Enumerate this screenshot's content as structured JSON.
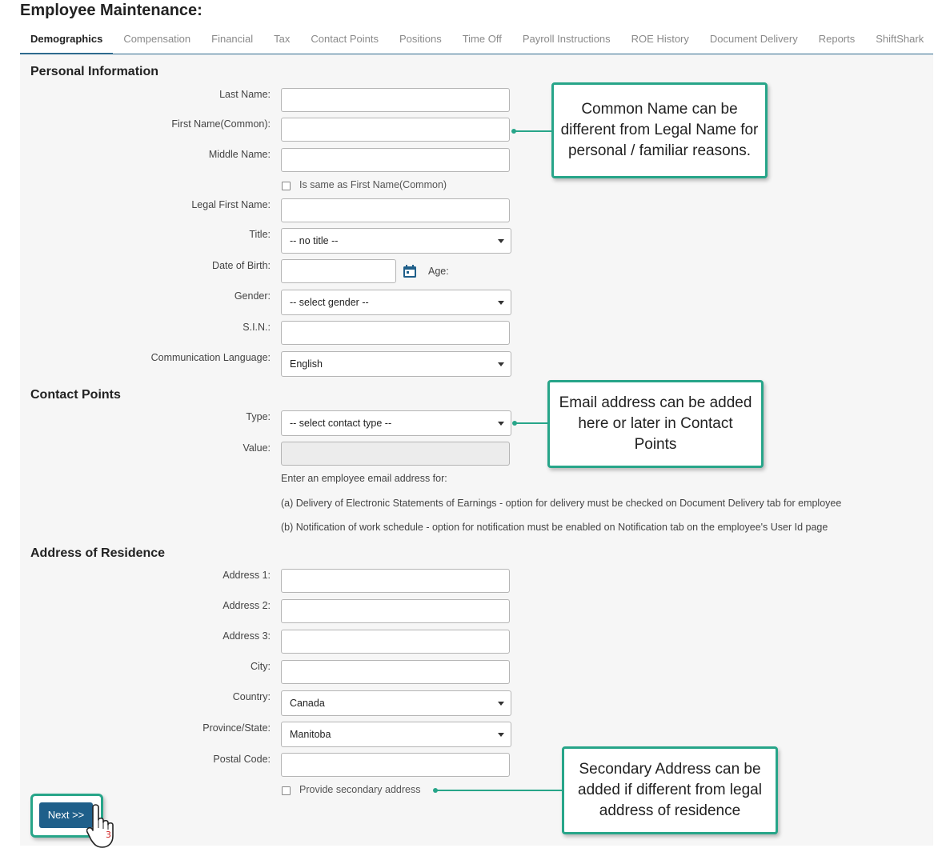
{
  "page": {
    "title": "Employee Maintenance:"
  },
  "tabs": [
    {
      "label": "Demographics"
    },
    {
      "label": "Compensation"
    },
    {
      "label": "Financial"
    },
    {
      "label": "Tax"
    },
    {
      "label": "Contact Points"
    },
    {
      "label": "Positions"
    },
    {
      "label": "Time Off"
    },
    {
      "label": "Payroll Instructions"
    },
    {
      "label": "ROE History"
    },
    {
      "label": "Document Delivery"
    },
    {
      "label": "Reports"
    },
    {
      "label": "ShiftShark"
    }
  ],
  "personal": {
    "heading": "Personal Information",
    "last_name_label": "Last Name:",
    "first_name_label": "First Name(Common):",
    "middle_name_label": "Middle Name:",
    "same_as_label": "Is same as First Name(Common)",
    "legal_first_label": "Legal First Name:",
    "title_label": "Title:",
    "title_value": "-- no title --",
    "dob_label": "Date of Birth:",
    "age_label": "Age:",
    "gender_label": "Gender:",
    "gender_value": "-- select gender --",
    "sin_label": "S.I.N.:",
    "language_label": "Communication Language:",
    "language_value": "English"
  },
  "contact": {
    "heading": "Contact Points",
    "type_label": "Type:",
    "type_value": "-- select contact type --",
    "value_label": "Value:",
    "help_intro": "Enter an employee email address for:",
    "help_a": "(a) Delivery of Electronic Statements of Earnings - option for delivery must be checked on Document Delivery tab for employee",
    "help_b": "(b) Notification of work schedule - option for notification must be enabled on Notification tab on the employee's User Id page"
  },
  "address": {
    "heading": "Address of Residence",
    "address1_label": "Address 1:",
    "address2_label": "Address 2:",
    "address3_label": "Address 3:",
    "city_label": "City:",
    "country_label": "Country:",
    "country_value": "Canada",
    "province_label": "Province/State:",
    "province_value": "Manitoba",
    "postal_label": "Postal Code:",
    "secondary_label": "Provide secondary address"
  },
  "callouts": {
    "common_name": "Common Name can be different from Legal Name for personal / familiar reasons.",
    "email": "Email address can be added here or later in Contact Points",
    "secondary": "Secondary Address can be added if different from legal address of residence"
  },
  "buttons": {
    "next": "Next >>"
  },
  "cursor": {
    "step_number": "3"
  },
  "colors": {
    "accent": "#27a589",
    "primary_button": "#1f5f8a",
    "tab_border": "#2e6a8e"
  },
  "icons": [
    "calendar-icon",
    "dropdown-caret-icon",
    "hand-pointer-icon"
  ]
}
